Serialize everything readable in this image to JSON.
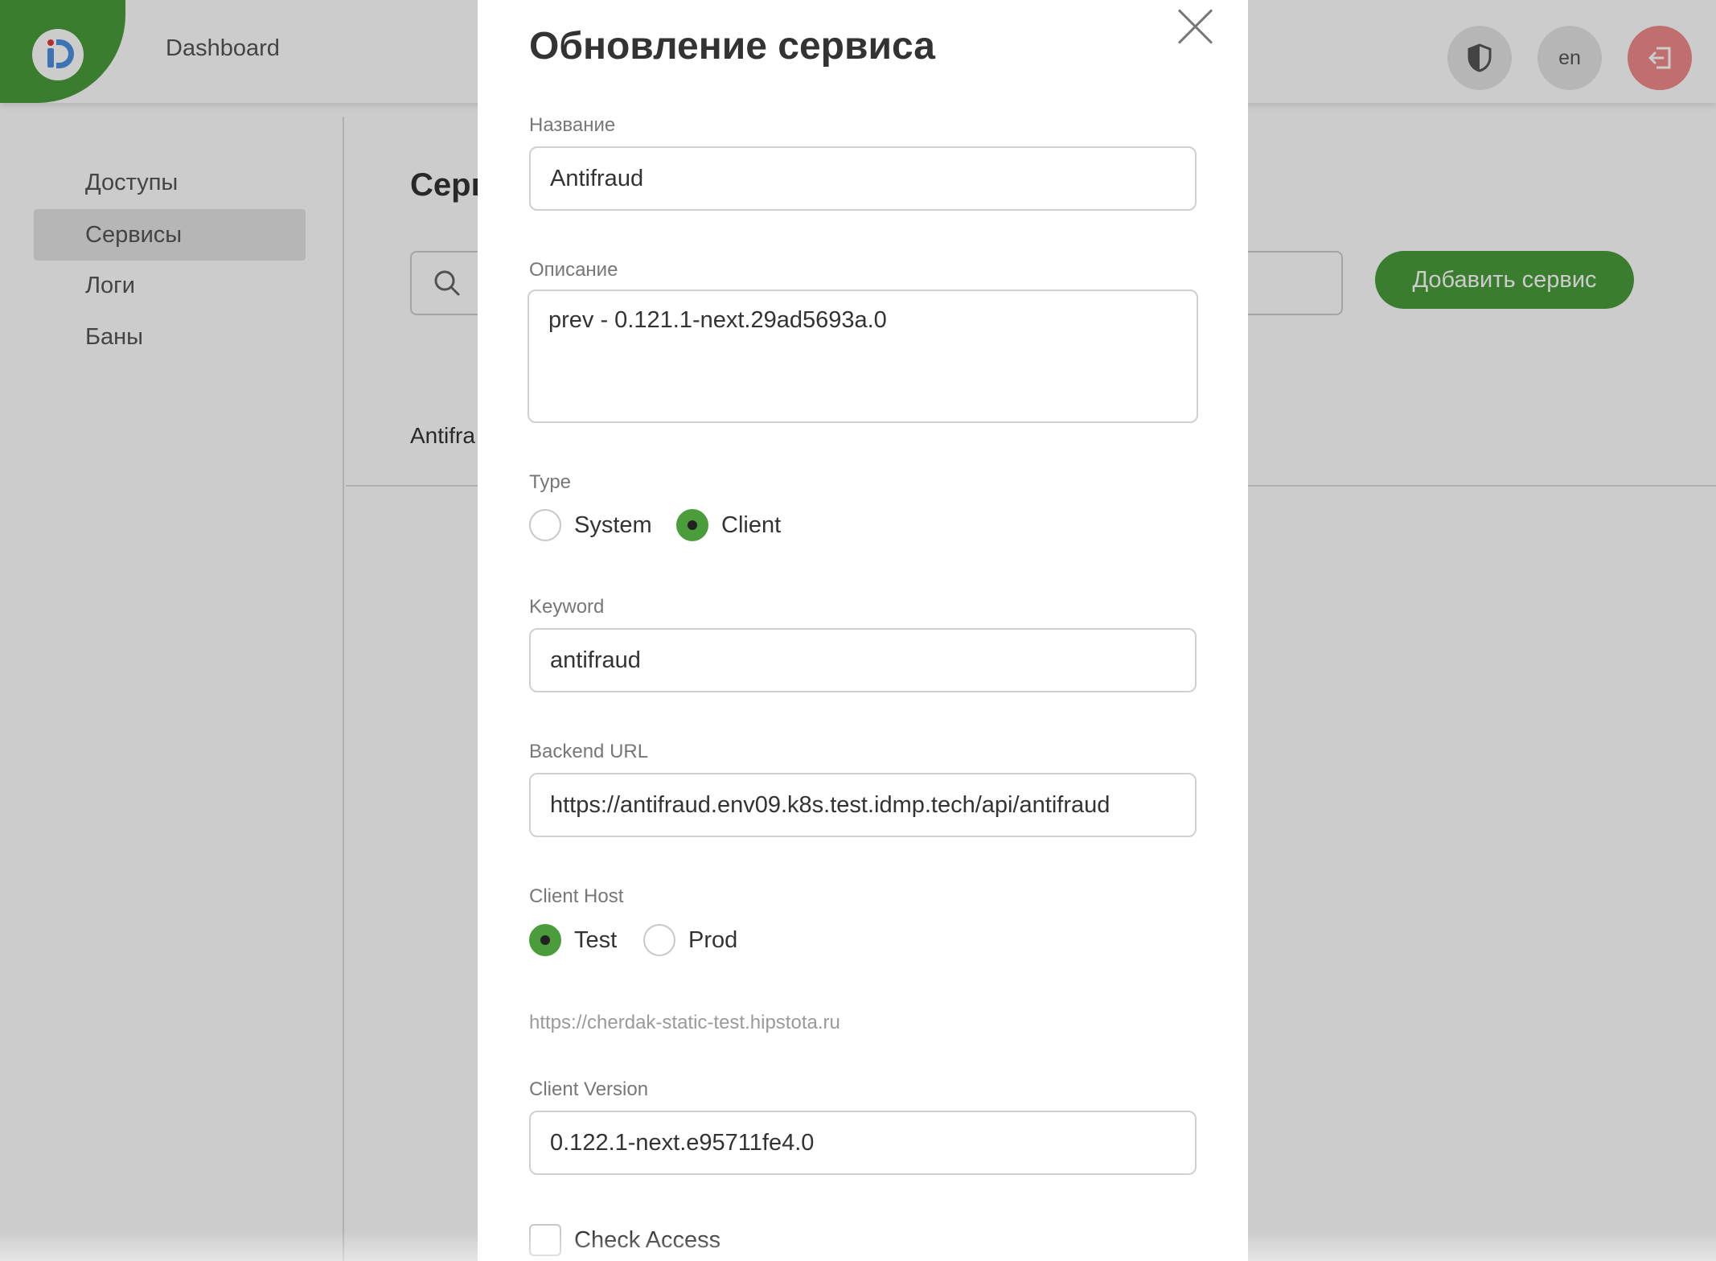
{
  "header": {
    "app_title": "Dashboard",
    "lang_label": "en",
    "shield_icon": "shield-icon",
    "logout_icon": "logout-icon"
  },
  "sidebar": {
    "items": [
      {
        "label": "Доступы",
        "active": false
      },
      {
        "label": "Сервисы",
        "active": true
      },
      {
        "label": "Логи",
        "active": false
      },
      {
        "label": "Баны",
        "active": false
      }
    ]
  },
  "main": {
    "title_visible": "Серв",
    "add_button": "Добавить сервис",
    "row_visible_text": "Antifra"
  },
  "modal": {
    "title": "Обновление сервиса",
    "name": {
      "label": "Название",
      "value": "Antifraud"
    },
    "description": {
      "label": "Описание",
      "value": "prev - 0.121.1-next.29ad5693a.0"
    },
    "type": {
      "label": "Type",
      "options": [
        "System",
        "Client"
      ],
      "selected": "Client"
    },
    "keyword": {
      "label": "Keyword",
      "value": "antifraud"
    },
    "backend_url": {
      "label": "Backend URL",
      "value": "https://antifraud.env09.k8s.test.idmp.tech/api/antifraud"
    },
    "client_host": {
      "label": "Client Host",
      "options": [
        "Test",
        "Prod"
      ],
      "selected": "Test",
      "hint": "https://cherdak-static-test.hipstota.ru"
    },
    "client_version": {
      "label": "Client Version",
      "value": "0.122.1-next.e95711fe4.0"
    },
    "check_access": {
      "label": "Check Access",
      "checked": false
    }
  },
  "colors": {
    "accent": "#4a9d3a",
    "logout": "#f08a8a"
  }
}
